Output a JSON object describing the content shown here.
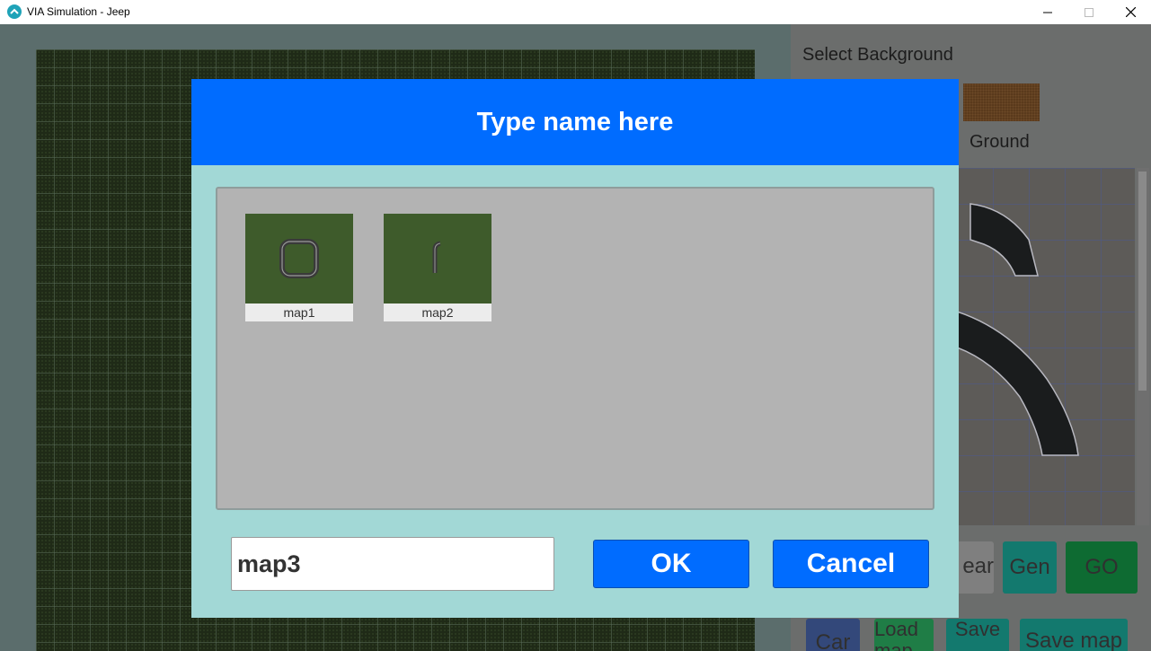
{
  "window": {
    "title": "VIA Simulation - Jeep",
    "controls": [
      "minimize",
      "maximize",
      "close"
    ]
  },
  "background_panel": {
    "select_background_label": "Select Background",
    "ground_label": "Ground",
    "buttons": {
      "clear": "ear",
      "gen": "Gen",
      "go": "GO",
      "car": "Car",
      "load_map": "Load map",
      "save": "Save",
      "save_map": "Save map"
    }
  },
  "dialog": {
    "title": "Type name here",
    "maps": [
      {
        "name": "map1",
        "thumbnail_icon": "loop-track-icon"
      },
      {
        "name": "map2",
        "thumbnail_icon": "curve-track-icon"
      }
    ],
    "name_input_value": "map3",
    "ok_label": "OK",
    "cancel_label": "Cancel"
  },
  "colors": {
    "dialog_header": "#006cff",
    "dialog_body": "#a2d8d6",
    "map_list_bg": "#b3b3b3",
    "map_thumb_bg": "#3e5b2b"
  }
}
